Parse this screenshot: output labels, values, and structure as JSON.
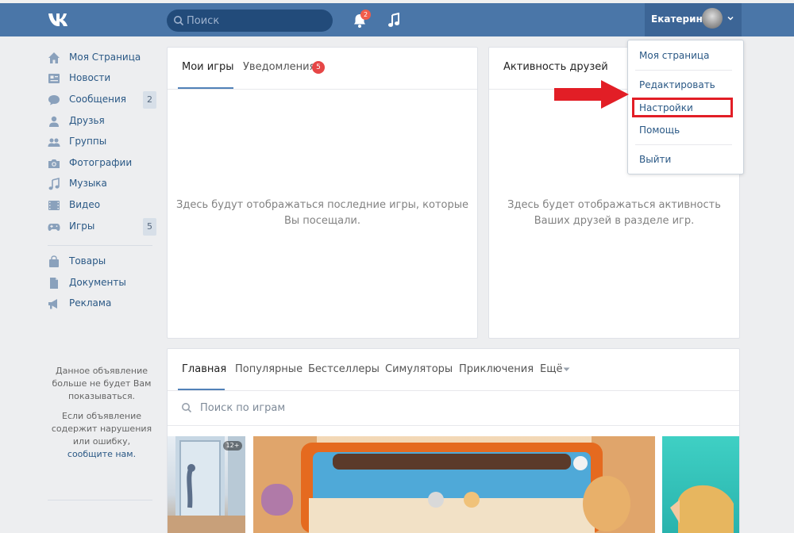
{
  "header": {
    "search_placeholder": "Поиск",
    "notifications_count": "2",
    "user_name": "Екатерина"
  },
  "sidebar": {
    "items": [
      {
        "label": "Моя Страница",
        "icon": "home-icon"
      },
      {
        "label": "Новости",
        "icon": "news-icon"
      },
      {
        "label": "Сообщения",
        "icon": "messages-icon",
        "count": "2"
      },
      {
        "label": "Друзья",
        "icon": "friends-icon"
      },
      {
        "label": "Группы",
        "icon": "groups-icon"
      },
      {
        "label": "Фотографии",
        "icon": "photos-icon"
      },
      {
        "label": "Музыка",
        "icon": "music-icon"
      },
      {
        "label": "Видео",
        "icon": "video-icon"
      },
      {
        "label": "Игры",
        "icon": "games-icon",
        "count": "5"
      },
      {
        "label": "Товары",
        "icon": "goods-icon"
      },
      {
        "label": "Документы",
        "icon": "documents-icon"
      },
      {
        "label": "Реклама",
        "icon": "ads-icon"
      }
    ],
    "ad_note_1": "Данное объявление больше не будет Вам показываться.",
    "ad_note_2_prefix": "Если объявление содержит нарушения или ошибку,",
    "ad_note_2_link": "сообщите нам."
  },
  "games_panel": {
    "tab_my_games": "Мои игры",
    "tab_notifications": "Уведомления",
    "notifications_badge": "5",
    "empty_line1": "Здесь будут отображаться последние игры, которые",
    "empty_line2": "Вы посещали."
  },
  "friends_panel": {
    "title": "Активность друзей",
    "empty_line1": "Здесь будет отображаться активность",
    "empty_line2": "Ваших друзей в разделе игр."
  },
  "catalog": {
    "tabs": [
      "Главная",
      "Популярные",
      "Бестселлеры",
      "Симуляторы",
      "Приключения",
      "Ещё"
    ],
    "search_placeholder": "Поиск по играм",
    "age_rating": "12+"
  },
  "dropdown": {
    "my_page": "Моя страница",
    "edit": "Редактировать",
    "settings": "Настройки",
    "help": "Помощь",
    "logout": "Выйти"
  },
  "colors": {
    "header": "#4a76a8",
    "link": "#2a5885",
    "highlight": "#e21e26"
  }
}
